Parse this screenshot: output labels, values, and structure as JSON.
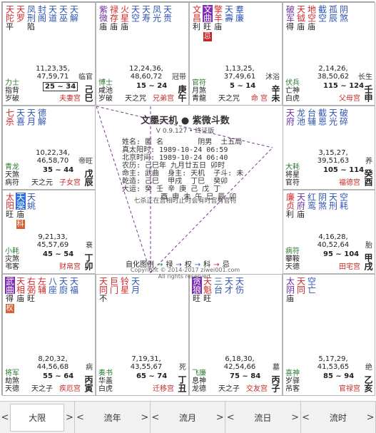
{
  "cells": [
    {
      "id": "si",
      "stars": [
        {
          "name": "天陀",
          "color": "red",
          "bright": "平",
          "sub": "",
          "stype": ""
        },
        {
          "name": "天罗",
          "color": "red",
          "bright": "",
          "sub": "",
          "stype": ""
        },
        {
          "name": "凤刑",
          "color": "blue",
          "bright": "陷",
          "sub": "",
          "stype": ""
        },
        {
          "name": "封阁",
          "color": "blue",
          "bright": "",
          "sub": "",
          "stype": ""
        },
        {
          "name": "天道",
          "color": "blue",
          "bright": "",
          "sub": "",
          "stype": ""
        },
        {
          "name": "天巫",
          "color": "blue",
          "bright": "",
          "sub": "",
          "stype": ""
        },
        {
          "name": "天解",
          "color": "blue",
          "bright": "",
          "sub": "",
          "stype": ""
        }
      ],
      "nums": "11,23,35,\n47,59,71",
      "range": "25 ~ 34",
      "boxed": true,
      "changsheng": "临官",
      "ganzhi": "己巳",
      "bl": [
        "力士",
        "指背",
        "岁破"
      ],
      "bm": "",
      "palace": "夫妻宫"
    },
    {
      "id": "wu",
      "stars": [
        {
          "name": "紫微",
          "color": "purple",
          "bright": "庙",
          "sub": "",
          "stype": ""
        },
        {
          "name": "禄存",
          "color": "red",
          "bright": "庙",
          "sub": "",
          "stype": ""
        },
        {
          "name": "火星",
          "color": "red",
          "bright": "庙",
          "sub": "",
          "stype": ""
        },
        {
          "name": "天空",
          "color": "blue",
          "bright": "",
          "sub": "",
          "stype": ""
        },
        {
          "name": "天寿",
          "color": "blue",
          "bright": "",
          "sub": "",
          "stype": ""
        },
        {
          "name": "凤光",
          "color": "blue",
          "bright": "",
          "sub": "",
          "stype": ""
        },
        {
          "name": "天贵",
          "color": "blue",
          "bright": "",
          "sub": "",
          "stype": ""
        }
      ],
      "nums": "12,24,36,\n48,60,72",
      "range": "15 ~ 24",
      "boxed": false,
      "changsheng": "冠带",
      "ganzhi": "庚午",
      "bl": [
        "博士",
        "咸池",
        "岁破"
      ],
      "bm": "天之咒",
      "palace": "兄弟宫"
    },
    {
      "id": "wei",
      "stars": [
        {
          "name": "文昌",
          "color": "red",
          "bright": "利",
          "sub": "",
          "stype": "",
          "hl": "none"
        },
        {
          "name": "文曲",
          "color": "purple",
          "bright": "旺",
          "sub": "忌",
          "stype": "red",
          "hl": "purple"
        },
        {
          "name": "擎羊",
          "color": "red",
          "bright": "庙",
          "sub": "",
          "stype": ""
        },
        {
          "name": "天壽",
          "color": "blue",
          "bright": "",
          "sub": "",
          "stype": ""
        },
        {
          "name": "羣廉",
          "color": "blue",
          "bright": "",
          "sub": "",
          "stype": ""
        }
      ],
      "nums": "1,13,25,\n37,49,61",
      "range": "5 ~ 14",
      "boxed": false,
      "changsheng": "沐浴",
      "ganzhi": "辛未",
      "bl": [
        "官符",
        "月煞",
        "青龍"
      ],
      "bm": "天之咒",
      "palace": "命 宫"
    },
    {
      "id": "shen",
      "stars": [
        {
          "name": "破军",
          "color": "purple",
          "bright": "得",
          "sub": "",
          "stype": ""
        },
        {
          "name": "天钺",
          "color": "red",
          "bright": "庙",
          "sub": "",
          "stype": ""
        },
        {
          "name": "地空",
          "color": "red",
          "bright": "庙",
          "sub": "",
          "stype": ""
        },
        {
          "name": "截空",
          "color": "blue",
          "bright": "",
          "sub": "",
          "stype": ""
        },
        {
          "name": "孤辰",
          "color": "blue",
          "bright": "",
          "sub": "",
          "stype": ""
        },
        {
          "name": "阴煞",
          "color": "blue",
          "bright": "",
          "sub": "",
          "stype": ""
        }
      ],
      "nums": "2,14,26,\n38,50,62",
      "range": "115 ~ 124",
      "boxed": false,
      "changsheng": "长生",
      "ganzhi": "壬申",
      "bl": [
        "伏兵",
        "亡神",
        "白虎"
      ],
      "bm": "",
      "palace": "父母宫"
    },
    {
      "id": "chen",
      "stars": [
        {
          "name": "七杀",
          "color": "red",
          "bright": "",
          "sub": "",
          "stype": ""
        },
        {
          "name": "天喜",
          "color": "blue",
          "bright": "",
          "sub": "",
          "stype": ""
        },
        {
          "name": "天月",
          "color": "blue",
          "bright": "",
          "sub": "",
          "stype": ""
        },
        {
          "name": "德解",
          "color": "blue",
          "bright": "",
          "sub": "",
          "stype": ""
        }
      ],
      "nums": "10,22,34,\n46,58,70",
      "range": "35 ~ 44",
      "boxed": false,
      "changsheng": "帝旺",
      "ganzhi": "戊辰",
      "bl": [
        "青龙",
        "天煞",
        "病符"
      ],
      "bm": "天之元",
      "palace": "子女宫"
    },
    {
      "id": "you",
      "stars": [
        {
          "name": "天府",
          "color": "purple",
          "bright": "",
          "sub": "",
          "stype": ""
        },
        {
          "name": "龙池",
          "color": "blue",
          "bright": "",
          "sub": "",
          "stype": ""
        },
        {
          "name": "台辅",
          "color": "blue",
          "bright": "",
          "sub": "",
          "stype": ""
        },
        {
          "name": "截恩",
          "color": "blue",
          "bright": "",
          "sub": "",
          "stype": ""
        },
        {
          "name": "天光",
          "color": "blue",
          "bright": "",
          "sub": "",
          "stype": ""
        },
        {
          "name": "破碎",
          "color": "blue",
          "bright": "",
          "sub": "",
          "stype": ""
        }
      ],
      "nums": "3,15,27,\n39,51,63",
      "range": "105 ~ 114",
      "boxed": false,
      "changsheng": "养",
      "ganzhi": "癸酉",
      "bl": [
        "大耗",
        "将星",
        "官符"
      ],
      "bm": "",
      "palace": "福德宫"
    },
    {
      "id": "mao",
      "stars": [
        {
          "name": "太阳",
          "color": "red",
          "bright": "旺",
          "sub": "",
          "stype": ""
        },
        {
          "name": "天梁",
          "color": "blue",
          "bright": "庙",
          "sub": "科",
          "stype": "",
          "hl": "blue"
        },
        {
          "name": "天姚",
          "color": "blue",
          "bright": "",
          "sub": "",
          "stype": ""
        }
      ],
      "nums": "9,21,33,\n45,57,69",
      "range": "45 ~ 54",
      "boxed": false,
      "changsheng": "衰",
      "ganzhi": "丁卯",
      "bl": [
        "小耗",
        "灾煞",
        "弔客"
      ],
      "bm": "",
      "palace": "财帛宫"
    },
    {
      "id": "xu",
      "stars": [
        {
          "name": "廉贞",
          "color": "red",
          "bright": "利",
          "sub": "",
          "stype": ""
        },
        {
          "name": "天府",
          "color": "purple",
          "bright": "庙",
          "sub": "",
          "stype": ""
        },
        {
          "name": "红鸾",
          "color": "blue",
          "bright": "",
          "sub": "",
          "stype": ""
        },
        {
          "name": "阴煞",
          "color": "blue",
          "bright": "",
          "sub": "",
          "stype": ""
        },
        {
          "name": "天刑",
          "color": "blue",
          "bright": "",
          "sub": "",
          "stype": ""
        },
        {
          "name": "空耗",
          "color": "blue",
          "bright": "",
          "sub": "",
          "stype": ""
        }
      ],
      "nums": "4,16,28,\n40,52,64",
      "range": "95 ~ 104",
      "boxed": false,
      "changsheng": "胎",
      "ganzhi": "甲戌",
      "bl": [
        "病符",
        "攀鞍",
        "天德"
      ],
      "bm": "",
      "palace": "田宅宫"
    },
    {
      "id": "yin",
      "stars": [
        {
          "name": "武曲",
          "color": "purple",
          "bright": "得",
          "sub": "权",
          "stype": "",
          "hl": "green"
        },
        {
          "name": "天相",
          "color": "red",
          "bright": "庙",
          "sub": "",
          "stype": ""
        },
        {
          "name": "右弼",
          "color": "red",
          "bright": "旺",
          "sub": "",
          "stype": ""
        },
        {
          "name": "左辅",
          "color": "red",
          "bright": "",
          "sub": "",
          "stype": ""
        },
        {
          "name": "八座",
          "color": "blue",
          "bright": "",
          "sub": "",
          "stype": ""
        },
        {
          "name": "天廚",
          "color": "blue",
          "bright": "",
          "sub": "",
          "stype": ""
        },
        {
          "name": "天福",
          "color": "blue",
          "bright": "",
          "sub": "",
          "stype": ""
        }
      ],
      "nums": "8,20,32,\n44,56,68",
      "range": "55 ~ 64",
      "boxed": false,
      "changsheng": "病",
      "ganzhi": "丙寅",
      "bl": [
        "将军",
        "劫煞",
        "天德"
      ],
      "bm": "天之子",
      "palace": "疾厄宫"
    },
    {
      "id": "chou",
      "stars": [
        {
          "name": "天同",
          "color": "red",
          "bright": "不",
          "sub": "",
          "stype": ""
        },
        {
          "name": "巨门",
          "color": "red",
          "bright": "",
          "sub": "",
          "stype": ""
        },
        {
          "name": "铃星",
          "color": "red",
          "bright": "",
          "sub": "",
          "stype": ""
        },
        {
          "name": "天月",
          "color": "blue",
          "bright": "",
          "sub": "",
          "stype": ""
        }
      ],
      "nums": "7,19,31,\n43,55,67",
      "range": "65 ~ 74",
      "boxed": false,
      "changsheng": "死",
      "ganzhi": "丁丑",
      "bl": [
        "奏书",
        "华盖",
        "白虎"
      ],
      "bm": "",
      "palace": "迁移宫"
    },
    {
      "id": "zi",
      "stars": [
        {
          "name": "贪狼",
          "color": "purple",
          "bright": "旺",
          "sub": "",
          "stype": "",
          "hl": "purple"
        },
        {
          "name": "天魁",
          "color": "red",
          "bright": "旺",
          "sub": "",
          "stype": ""
        },
        {
          "name": "三台",
          "color": "blue",
          "bright": "",
          "sub": "",
          "stype": ""
        },
        {
          "name": "天才",
          "color": "blue",
          "bright": "",
          "sub": "",
          "stype": ""
        },
        {
          "name": "天伤",
          "color": "blue",
          "bright": "",
          "sub": "",
          "stype": ""
        }
      ],
      "nums": "6,18,30,\n42,54,66",
      "range": "75 ~ 84",
      "boxed": false,
      "changsheng": "墓",
      "ganzhi": "丙子",
      "bl": [
        "飞廉",
        "息神",
        "龙德"
      ],
      "bm": "天之子",
      "palace": "交友宫"
    },
    {
      "id": "hai",
      "stars": [
        {
          "name": "太阴",
          "color": "purple",
          "bright": "庙",
          "sub": "",
          "stype": ""
        },
        {
          "name": "天同",
          "color": "red",
          "bright": "",
          "sub": "",
          "stype": ""
        },
        {
          "name": "空亡",
          "color": "blue",
          "bright": "",
          "sub": "",
          "stype": ""
        }
      ],
      "nums": "5,17,29,\n41,53,65",
      "range": "85 ~ 94",
      "boxed": false,
      "changsheng": "绝",
      "ganzhi": "乙亥",
      "bl": [
        "喜神",
        "岁驿",
        "吊客"
      ],
      "bm": "",
      "palace": "官禄宫"
    }
  ],
  "center": {
    "title": "文墨天机  ●  紫微斗数",
    "version": "V 0.9.127 • 终证版",
    "info": "姓名: 匿 名        阴男  土五局\n真太阳时: 1989-10-24 06:59\n北京时间: 1989-10-24 06:40\n农历: 己巳年 九月廿五日 卯时\n命主: 武曲  身主: 天机  子斗: 未\n乾造: 己巳  甲戌  丁巳  癸卯\n大运: 癸 壬 辛 庚 己 戊 丁\n         酉 申 未 午 巳 辰 卯",
    "note": "七杀正在宫相时止时会有时宫有官符",
    "legend_prefix": "自化图例",
    "legend": [
      {
        "arrow": "→",
        "label": "禄",
        "color": "#2a8a3a"
      },
      {
        "arrow": "→",
        "label": "权",
        "color": "#6b2ea3"
      },
      {
        "arrow": "→",
        "label": "科",
        "color": "#2d55b3"
      },
      {
        "arrow": "→",
        "label": "忌",
        "color": "#c92424"
      }
    ],
    "copyright": "Copyright © 2014-2017 ziwei001.com",
    "rights": "All rights reserved."
  },
  "tabs": [
    {
      "label": "大限",
      "active": true
    },
    {
      "label": "流年",
      "active": false
    },
    {
      "label": "流月",
      "active": false
    },
    {
      "label": "流日",
      "active": false
    },
    {
      "label": "流时",
      "active": false
    }
  ]
}
